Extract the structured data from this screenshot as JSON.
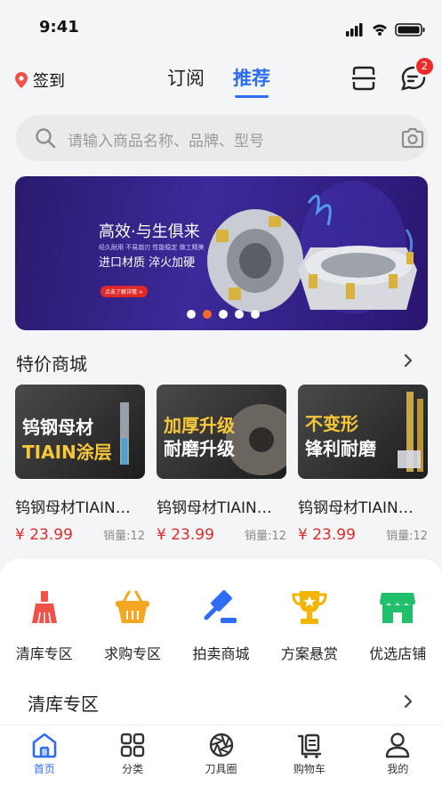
{
  "status": {
    "time": "9:41"
  },
  "header": {
    "checkin": "签到",
    "tabs": [
      {
        "label": "订阅",
        "active": false
      },
      {
        "label": "推荐",
        "active": true
      }
    ],
    "message_badge": "2"
  },
  "search": {
    "placeholder": "请输入商品名称、品牌、型号"
  },
  "banner": {
    "headline": "高效·与生俱来",
    "subline": "经久耐用  不易崩刃  性能稳定  做工精美",
    "tagline": "进口材质 淬火加硬",
    "cta": "点击了解详情 >",
    "slide_count": 5,
    "active_slide": 1
  },
  "special": {
    "title": "特价商城",
    "products": [
      {
        "img_line1": "钨钢母材",
        "img_line2": "TIAIN涂层",
        "name": "钨钢母材TIAIN涂层",
        "price": "¥ 23.99",
        "sales": "销量:12"
      },
      {
        "img_line1": "加厚升级",
        "img_line2": "耐磨升级",
        "name": "钨钢母材TIAIN涂层",
        "price": "¥ 23.99",
        "sales": "销量:12"
      },
      {
        "img_line1": "不变形",
        "img_line2": "锋利耐磨",
        "name": "钨钢母材TIAIN涂层",
        "price": "¥ 23.99",
        "sales": "销量:12"
      }
    ]
  },
  "categories": [
    {
      "label": "清库专区",
      "icon": "broom-icon",
      "color": "#f0524a"
    },
    {
      "label": "求购专区",
      "icon": "basket-icon",
      "color": "#f5a623"
    },
    {
      "label": "拍卖商城",
      "icon": "gavel-icon",
      "color": "#2d6cf5"
    },
    {
      "label": "方案悬赏",
      "icon": "trophy-icon",
      "color": "#f5b400"
    },
    {
      "label": "优选店铺",
      "icon": "store-icon",
      "color": "#1fbf6b"
    }
  ],
  "clearance": {
    "title": "清库专区"
  },
  "tabbar": [
    {
      "label": "首页",
      "icon": "home-icon",
      "active": true
    },
    {
      "label": "分类",
      "icon": "grid-icon",
      "active": false
    },
    {
      "label": "刀具圈",
      "icon": "aperture-icon",
      "active": false
    },
    {
      "label": "购物车",
      "icon": "cart-icon",
      "active": false
    },
    {
      "label": "我的",
      "icon": "user-icon",
      "active": false
    }
  ],
  "colors": {
    "accent": "#2d6cf5",
    "price": "#e02a2a",
    "badge": "#ee2b2b",
    "banner_dot_active": "#f26a2c"
  }
}
